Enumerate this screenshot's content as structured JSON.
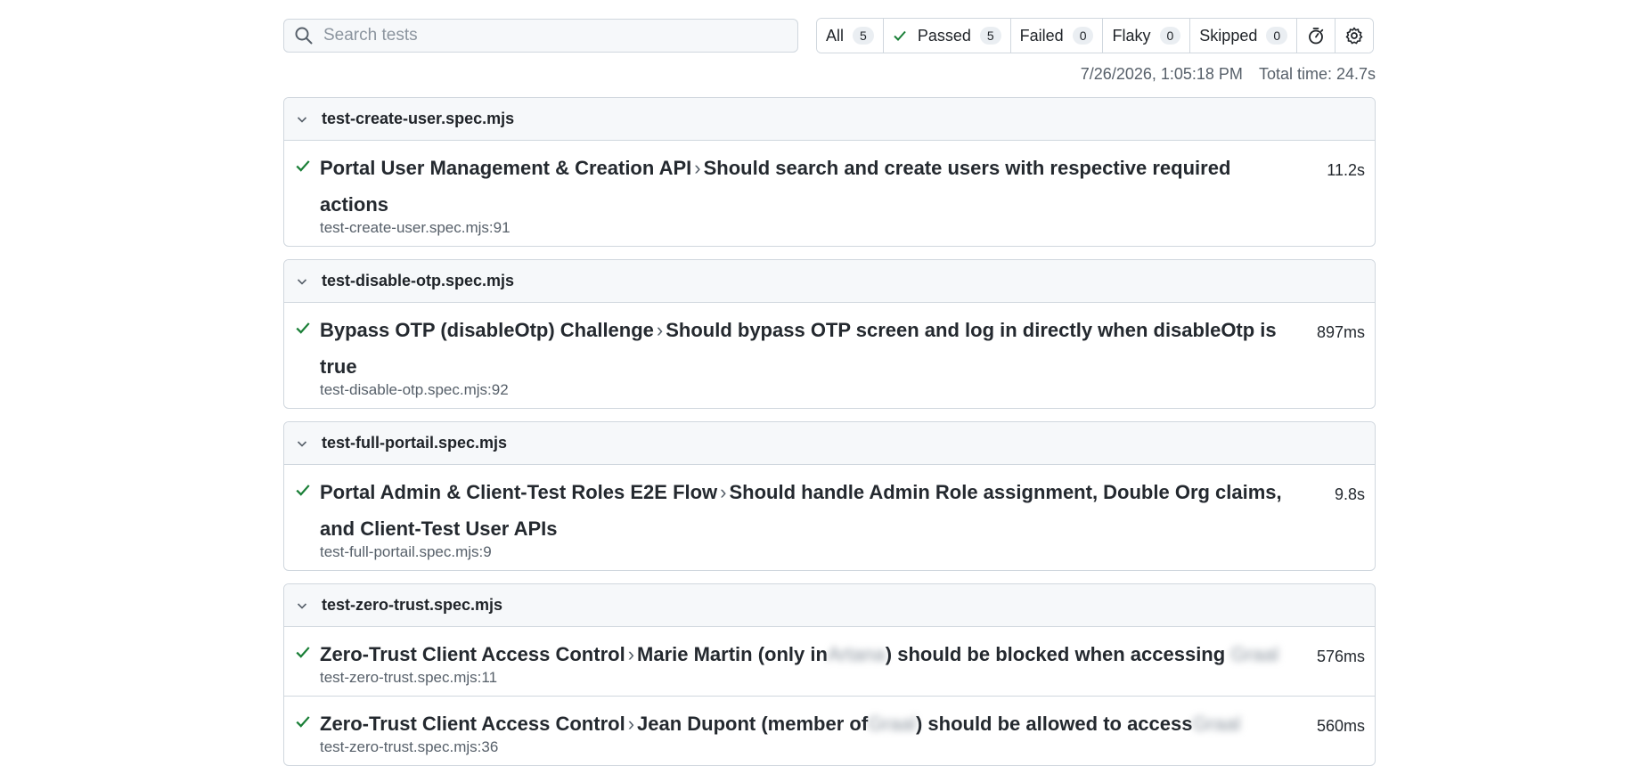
{
  "search": {
    "placeholder": "Search tests"
  },
  "filters": [
    {
      "label": "All",
      "count": "5"
    },
    {
      "label": "Passed",
      "count": "5"
    },
    {
      "label": "Failed",
      "count": "0"
    },
    {
      "label": "Flaky",
      "count": "0"
    },
    {
      "label": "Skipped",
      "count": "0"
    }
  ],
  "meta": {
    "timestamp": "7/26/2026, 1:05:18 PM",
    "total_time": "Total time: 24.7s"
  },
  "colors": {
    "pass": "#1a7f37",
    "muted": "#57606a",
    "border": "#d0d7de"
  },
  "groups": [
    {
      "file": "test-create-user.spec.mjs",
      "tests": [
        {
          "suite": "Portal User Management & Creation API",
          "sep": "›",
          "name": "Should search and create users with respective required actions",
          "location": "test-create-user.spec.mjs:91",
          "duration": "11.2s"
        }
      ]
    },
    {
      "file": "test-disable-otp.spec.mjs",
      "tests": [
        {
          "suite": "Bypass OTP (disableOtp) Challenge",
          "sep": "›",
          "name": "Should bypass OTP screen and log in directly when disableOtp is true",
          "location": "test-disable-otp.spec.mjs:92",
          "duration": "897ms"
        }
      ]
    },
    {
      "file": "test-full-portail.spec.mjs",
      "tests": [
        {
          "suite": "Portal Admin & Client-Test Roles E2E Flow",
          "sep": "›",
          "name": "Should handle Admin Role assignment, Double Org claims, and Client-Test User APIs",
          "location": "test-full-portail.spec.mjs:9",
          "duration": "9.8s"
        }
      ]
    },
    {
      "file": "test-zero-trust.spec.mjs",
      "tests": [
        {
          "suite": "Zero-Trust Client Access Control",
          "sep": "›",
          "name_a": "Marie Martin (only in",
          "blur_a": "Artana",
          "name_b": ") should be blocked when accessing",
          "blur_b": "Graal",
          "location": "test-zero-trust.spec.mjs:11",
          "duration": "576ms"
        },
        {
          "suite": "Zero-Trust Client Access Control",
          "sep": "›",
          "name_a": "Jean Dupont (member of",
          "blur_a": "Graal",
          "name_b": ") should be allowed to access",
          "blur_b": "Graal",
          "location": "test-zero-trust.spec.mjs:36",
          "duration": "560ms"
        }
      ]
    }
  ]
}
